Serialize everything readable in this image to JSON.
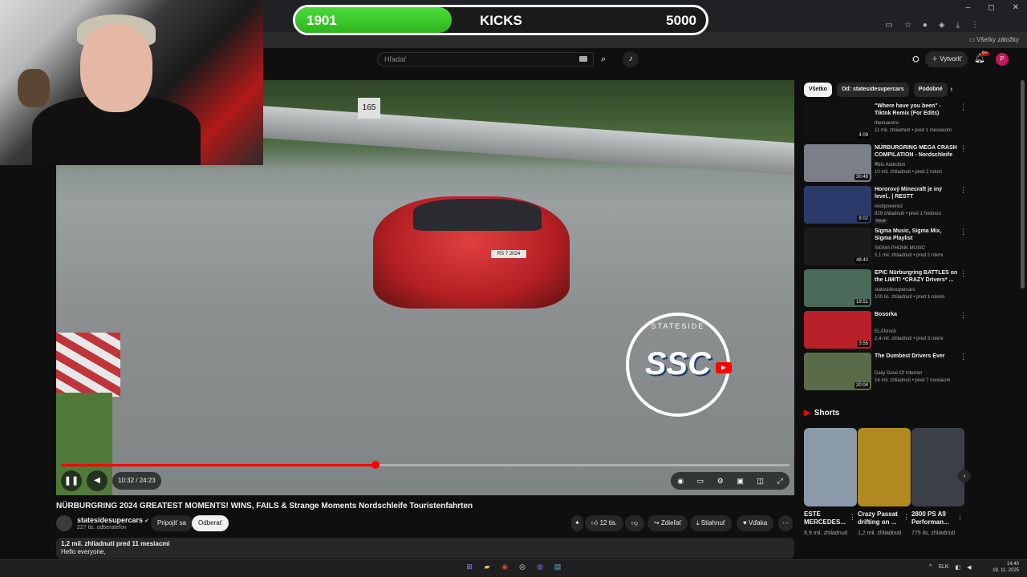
{
  "overlay": {
    "kicks_current": "1901",
    "kicks_label": "KICKS",
    "kicks_goal": "5000",
    "progress": 0.38
  },
  "browser": {
    "bookmarks_label": "Všetky záložky",
    "window_controls": [
      "–",
      "◻",
      "✕"
    ]
  },
  "header": {
    "search_placeholder": "Hľadať",
    "create_label": "Vytvoriť",
    "notifications_count": "9+",
    "avatar_letter": "P"
  },
  "player": {
    "sign_text": "165",
    "plate_text": "RS 7 2024",
    "logo_text": "SSC",
    "logo_ring": "STATESIDE",
    "time_display": "10:32 / 24:23",
    "progress": 0.432
  },
  "video": {
    "title": "NÜRBURGRING 2024 GREATEST MOMENTS! WINS, FAILS & Strange Moments Nordschleife Touristenfahrten",
    "channel_name": "statesidesupercars",
    "channel_subs": "227 tis. odberateľov",
    "join_label": "Pripojiť sa",
    "subscribe_label": "Odberať",
    "likes": "12 tis.",
    "share_label": "Zdieľať",
    "download_label": "Stiahnuť",
    "thanks_label": "Vďaka",
    "desc_stats": "1,2 mil. zhliadnutí  pred 11 mesiacmi",
    "desc_first_line": "Hello everyone,"
  },
  "chips": [
    "Všetko",
    "Od: statesidesupercars",
    "Podobné"
  ],
  "recommendations": [
    {
      "title": "\"Where have you been\" - Tiktok Remix (For Edits)",
      "channel": "themaestro",
      "meta": "11 mil. zhliadnutí • pred 1 mesiacom",
      "duration": "4:09",
      "badge": "",
      "thumb_color": "#111111"
    },
    {
      "title": "NÜRBURGRING MEGA CRASH COMPILATION - Nordschleife ...",
      "channel": "Auto Addiction",
      "meta": "10 mil. zhliadnutí • pred 2 rokmi",
      "duration": "30:48",
      "badge": "",
      "thumb_color": "#7a7f8a"
    },
    {
      "title": "Hororový Minecraft je iný level.. | RESTT",
      "channel": "resttpowered",
      "meta": "929 zhliadnutí • pred 1 hodinou",
      "duration": "8:02",
      "badge": "Nové",
      "thumb_color": "#2a3a6a"
    },
    {
      "title": "Sigma Music, Sigma Mix, Sigma Playlist",
      "channel": "SIGMA PHONK MUSIC",
      "meta": "5,1 mil. zhliadnutí • pred 2 rokmi",
      "duration": "48:40",
      "badge": "",
      "thumb_color": "#1b1b1b"
    },
    {
      "title": "EPIC Nürburgring BATTLES on the LIMIT! *CRAZY Drivers* ...",
      "channel": "statesidesupercars",
      "meta": "100 tis. zhliadnutí • pred 1 rokom",
      "duration": "19:51",
      "badge": "",
      "thumb_color": "#4b6a5a"
    },
    {
      "title": "Bosorka",
      "channel": "ELÁNrock",
      "meta": "2,4 mil. zhliadnutí • pred 3 rokmi",
      "duration": "3:55",
      "badge": "",
      "thumb_color": "#b8202a"
    },
    {
      "title": "The Dumbest Drivers Ever",
      "channel": "Daily Dose Of Internet",
      "meta": "16 mil. zhliadnutí • pred 7 mesiacmi",
      "duration": "20:04",
      "badge": "",
      "thumb_color": "#5a6b4a"
    }
  ],
  "shorts": {
    "heading": "Shorts",
    "items": [
      {
        "title": "ESTE MERCEDES...",
        "views": "8,9 mil. zhliadnutí",
        "thumb_color": "#8a9aa8"
      },
      {
        "title": "Crazy Passat drifting on ...",
        "views": "1,2 mil. zhliadnutí",
        "thumb_color": "#b08a20"
      },
      {
        "title": "2800 PS A9 Performan...",
        "views": "775 tis. zhliadnutí",
        "thumb_color": "#3a3f48"
      }
    ]
  },
  "taskbar": {
    "language": "SLK",
    "time": "14:40",
    "date": "19. 11. 2025"
  },
  "colors": {
    "accent_red": "#ff0000",
    "kicks_green": "#3fcf2c",
    "bg": "#0f0f0f"
  }
}
